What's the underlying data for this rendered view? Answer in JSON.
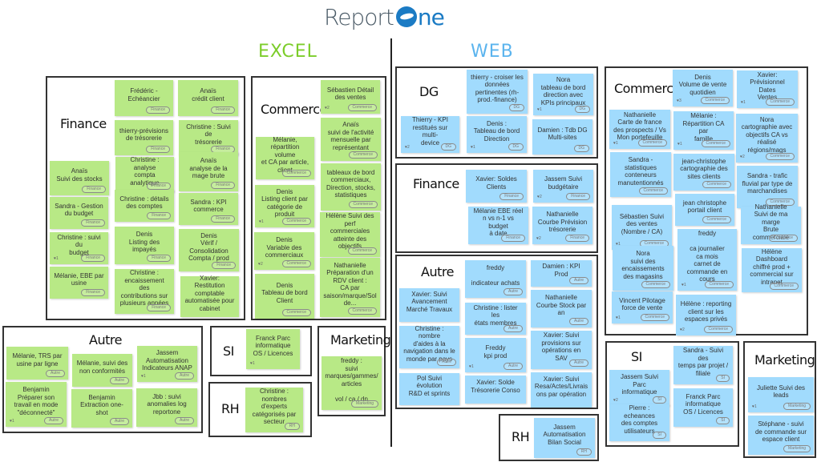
{
  "header": {
    "logo_report": "Report",
    "logo_one": "ne",
    "brand_colors": {
      "report": "#4a5a66",
      "one": "#1b7bc4"
    }
  },
  "sections": {
    "excel": {
      "title": "EXCEL",
      "color": "#7ccd2a"
    },
    "web": {
      "title": "WEB",
      "color": "#5bb4ee"
    }
  },
  "colors": {
    "excel_card": "#b8e986",
    "web_card": "#a1dbfd"
  },
  "boards": {
    "excel_finance": {
      "title": "Finance",
      "cards": [
        {
          "text": "Frédéric -\nEchéancier",
          "tag": "Finance",
          "likes": ""
        },
        {
          "text": "Anaïs\ncrédit client",
          "tag": "Finance",
          "likes": ""
        },
        {
          "text": "thierry-prévisions\nde trésorerie",
          "tag": "Finance",
          "likes": ""
        },
        {
          "text": "Christine : Suivi de\ntrésorerie",
          "tag": "Finance",
          "likes": ""
        },
        {
          "text": "Anaïs\nSuivi des stocks",
          "tag": "Finance",
          "likes": ""
        },
        {
          "text": "Christine : analyse\ncompta analytique",
          "tag": "Finance",
          "likes": ""
        },
        {
          "text": "Anaïs\nanalyse de la\nmage brute",
          "tag": "Finance",
          "likes": ""
        },
        {
          "text": "Sandra - Gestion\ndu budget",
          "tag": "Finance",
          "likes": ""
        },
        {
          "text": "Christine : détails\ndes comptes",
          "tag": "Finance",
          "likes": ""
        },
        {
          "text": "Sandra : KPI\ncommerce",
          "tag": "Finance",
          "likes": ""
        },
        {
          "text": "Christine : suivi du\nbudget",
          "tag": "Finance",
          "likes": "♥1"
        },
        {
          "text": "Denis\nListing des\nimpayés",
          "tag": "Finance",
          "likes": ""
        },
        {
          "text": "Denis\nVérif /\nConsolidation\nCompta / prod",
          "tag": "Finance",
          "likes": ""
        },
        {
          "text": "Mélanie, EBE par\nusine",
          "tag": "Finance",
          "likes": ""
        },
        {
          "text": "Christine :\nencaissement des\ncontributions sur\nplusieurs années",
          "tag": "Finance",
          "likes": ""
        },
        {
          "text": "Xavier: Restitution\ncomptable\nautomatisée pour\ncabinet",
          "tag": "",
          "likes": ""
        }
      ]
    },
    "excel_commerce": {
      "title": "Commerce",
      "cards": [
        {
          "text": "Sébastien Détail\ndes ventes",
          "tag": "Commerce",
          "likes": "♥2"
        },
        {
          "text": "Anaïs\nsuivi de l'activité\nmensuelle par\nreprésentant",
          "tag": "Commerce",
          "likes": ""
        },
        {
          "text": "Mélanie,\nrépartition volume\net CA par article,\nclient",
          "tag": "Commerce",
          "likes": ""
        },
        {
          "text": "tableaux de bord\ncommerciaux,\nDirection, stocks,\nstatistiques",
          "tag": "Commerce",
          "likes": ""
        },
        {
          "text": "Denis\nListing client par\ncatégorie de\nproduit",
          "tag": "Commerce",
          "likes": "♥1"
        },
        {
          "text": "Hélène Suivi des\nperf commerciales\natteinte des\nobjectifs",
          "tag": "Commerce",
          "likes": ""
        },
        {
          "text": "Denis\nVariable des\ncommerciaux",
          "tag": "Commerce",
          "likes": "♥2"
        },
        {
          "text": "Denis\nTableau de bord\nClient",
          "tag": "Commerce",
          "likes": ""
        },
        {
          "text": "Nathanielle\nPréparation d'un\nRDV client :\nCA par\nsaison/marque/Sol\nde...",
          "tag": "Commerce",
          "likes": ""
        }
      ]
    },
    "excel_autre": {
      "title": "Autre",
      "cards": [
        {
          "text": "Mélanie, TRS par\nusine par ligne",
          "tag": "Autre",
          "likes": ""
        },
        {
          "text": "Mélanie, suivi des\nnon conformités",
          "tag": "Autre",
          "likes": ""
        },
        {
          "text": "Jassem\nAutomatisation\nIndicateurs ANAP",
          "tag": "Autre",
          "likes": "♥1"
        },
        {
          "text": "Benjamin\nPréparer son\ntravail en mode\n\"déconnecté\"",
          "tag": "Autre",
          "likes": "♥1"
        },
        {
          "text": "Benjamin\nExtraction one-\nshot",
          "tag": "Autre",
          "likes": ""
        },
        {
          "text": "Jbb : suivi\nanomalies log\nreportone",
          "tag": "Autre",
          "likes": ""
        }
      ]
    },
    "excel_si": {
      "title": "SI",
      "cards": [
        {
          "text": "Franck Parc\ninformatique\nOS / Licences",
          "tag": "",
          "likes": "♥1"
        }
      ]
    },
    "excel_rh": {
      "title": "RH",
      "cards": [
        {
          "text": "Christine :\nnombres d'experts\ncatégorisés par\nsecteur",
          "tag": "RH",
          "likes": ""
        }
      ]
    },
    "excel_marketing": {
      "title": "Marketing",
      "cards": [
        {
          "text": "freddy :\nsuivi\nmarques/gammes/\narticles\n\nvol / ca / dn",
          "tag": "Marketing",
          "likes": ""
        }
      ]
    },
    "web_dg": {
      "title": "DG",
      "cards": [
        {
          "text": "thierry - croiser les\ndonnées\npertinentes (rh-\nprod.-finance)",
          "tag": "DG",
          "likes": ""
        },
        {
          "text": "Nora\ntableau de bord\ndirection avec\nKPIs principaux",
          "tag": "DG",
          "likes": "♥1"
        },
        {
          "text": "Thierry - KPI\nrestitués sur multi-\ndevice",
          "tag": "DG",
          "likes": "♥2"
        },
        {
          "text": "Denis :\nTableau de bord\nDirection",
          "tag": "DG",
          "likes": "♥1"
        },
        {
          "text": "Damien : Tdb DG\nMulti-sites",
          "tag": "DG",
          "likes": ""
        }
      ]
    },
    "web_finance": {
      "title": "Finance",
      "cards": [
        {
          "text": "Xavier: Soldes\nClients",
          "tag": "Finance",
          "likes": ""
        },
        {
          "text": "Jassem Suivi\nbudgétaire",
          "tag": "Finance",
          "likes": "♥2"
        },
        {
          "text": "Mélanie EBE réel\nn vs n-1 vs budget\nà date",
          "tag": "Finance",
          "likes": ""
        },
        {
          "text": "Nathanielle\nCourbe Prévision\ntrésorerie",
          "tag": "Finance",
          "likes": "♥2"
        }
      ]
    },
    "web_autre": {
      "title": "Autre",
      "cards": [
        {
          "text": "freddy\n\nindicateur achats",
          "tag": "Autre",
          "likes": ""
        },
        {
          "text": "Damien : KPI Prod",
          "tag": "Autre",
          "likes": ""
        },
        {
          "text": "Xavier: Suivi\nAvancement\nMarché Travaux",
          "tag": "",
          "likes": ""
        },
        {
          "text": "Christine : lister les\nétats membres",
          "tag": "Autre",
          "likes": ""
        },
        {
          "text": "Nathanielle\nCourbe Stock par\nan",
          "tag": "Autre",
          "likes": ""
        },
        {
          "text": "Christine : nombre\nd'aides à la\nnavigation dans le\nmonde par pays",
          "tag": "Autre",
          "likes": ""
        },
        {
          "text": "Freddy\nkpi prod",
          "tag": "Autre",
          "likes": "♥1"
        },
        {
          "text": "Xavier: Suivi\nprovisions sur\nopérations en SAV",
          "tag": "Autre",
          "likes": ""
        },
        {
          "text": "Pol Suivi évolution\nR&D et sprints",
          "tag": "",
          "likes": ""
        },
        {
          "text": "Xavier: Solde\nTrésorerie Conso",
          "tag": "",
          "likes": ""
        },
        {
          "text": "Xavier: Suivi\nResa/Actes/Livrais\nons par opération",
          "tag": "",
          "likes": ""
        }
      ]
    },
    "web_rh": {
      "title": "RH",
      "cards": [
        {
          "text": "Jassem\nAutomatisation\nBilan Social",
          "tag": "RH",
          "likes": ""
        }
      ]
    },
    "web_commerce": {
      "title": "Commerce",
      "cards": [
        {
          "text": "Denis\nVolume de vente\nquotidien",
          "tag": "Commerce",
          "likes": "♥3"
        },
        {
          "text": "Xavier:\nPrévisionnel Dates\nVentes",
          "tag": "Commerce",
          "likes": "♥1"
        },
        {
          "text": "Nathanielle\nCarte de france\ndes prospects / Vs\nMon portefeuille",
          "tag": "Commerce",
          "likes": "♥1"
        },
        {
          "text": "Mélanie :\nRépartition CA par\nfamille",
          "tag": "Commerce",
          "likes": "♥1"
        },
        {
          "text": "Nora\ncartographie avec\nobjectifs CA vs\nréalisé\nrégions/mags",
          "tag": "Commerce",
          "likes": "♥2"
        },
        {
          "text": "Sandra -\nstatistiques\nconteneurs\nmanutentionnés",
          "tag": "Commerce",
          "likes": ""
        },
        {
          "text": "jean-christophe\ncartographie des\nsites clients",
          "tag": "Commerce",
          "likes": ""
        },
        {
          "text": "Sandra - trafic\nfluvial par type de\nmarchandises",
          "tag": "Commerce",
          "likes": ""
        },
        {
          "text": "jean christophe\nportail client",
          "tag": "Commerce",
          "likes": ""
        },
        {
          "text": "Sébastien Suivi\ndes ventes\n(Nombre / CA)",
          "tag": "Commerce",
          "likes": "♥1"
        },
        {
          "text": "Nathanielle\nSuivi de ma marge\nBrute commerciale",
          "tag": "Commerce",
          "likes": ""
        },
        {
          "text": "freddy\n\nca journalier\nca mois\ncarnet de\ncommande en\ncours",
          "tag": "Commerce",
          "likes": "♥1"
        },
        {
          "text": "Nora\nsuivi des\nencaissements\ndes magasins",
          "tag": "Commerce",
          "likes": ""
        },
        {
          "text": "Hélène Dashboard\nchiffré prod +\ncommercial sur\nintranet",
          "tag": "Commerce",
          "likes": ""
        },
        {
          "text": "Vincent Pilotage\nforce de vente",
          "tag": "Commerce",
          "likes": "♥1"
        },
        {
          "text": "Hélène : reporting\nclient sur les\nespaces privés",
          "tag": "Commerce",
          "likes": "♥2"
        }
      ]
    },
    "web_si": {
      "title": "SI",
      "cards": [
        {
          "text": "Sandra - Suivi des\ntemps par projet /\nfiliale",
          "tag": "SI",
          "likes": ""
        },
        {
          "text": "Jassem Suivi Parc\ninformatique",
          "tag": "SI",
          "likes": "♥2"
        },
        {
          "text": "Franck Parc\ninformatique\nOS / Licences",
          "tag": "SI",
          "likes": ""
        },
        {
          "text": "Pierre : echeances\ndes comptes\nutilisateurs",
          "tag": "SI",
          "likes": ""
        }
      ]
    },
    "web_marketing": {
      "title": "Marketing",
      "cards": [
        {
          "text": "Juliette Suivi des\nleads",
          "tag": "Marketing",
          "likes": "♥1"
        },
        {
          "text": "Stéphane - suivi\nde commande sur\nespace client",
          "tag": "Marketing",
          "likes": ""
        }
      ]
    }
  }
}
